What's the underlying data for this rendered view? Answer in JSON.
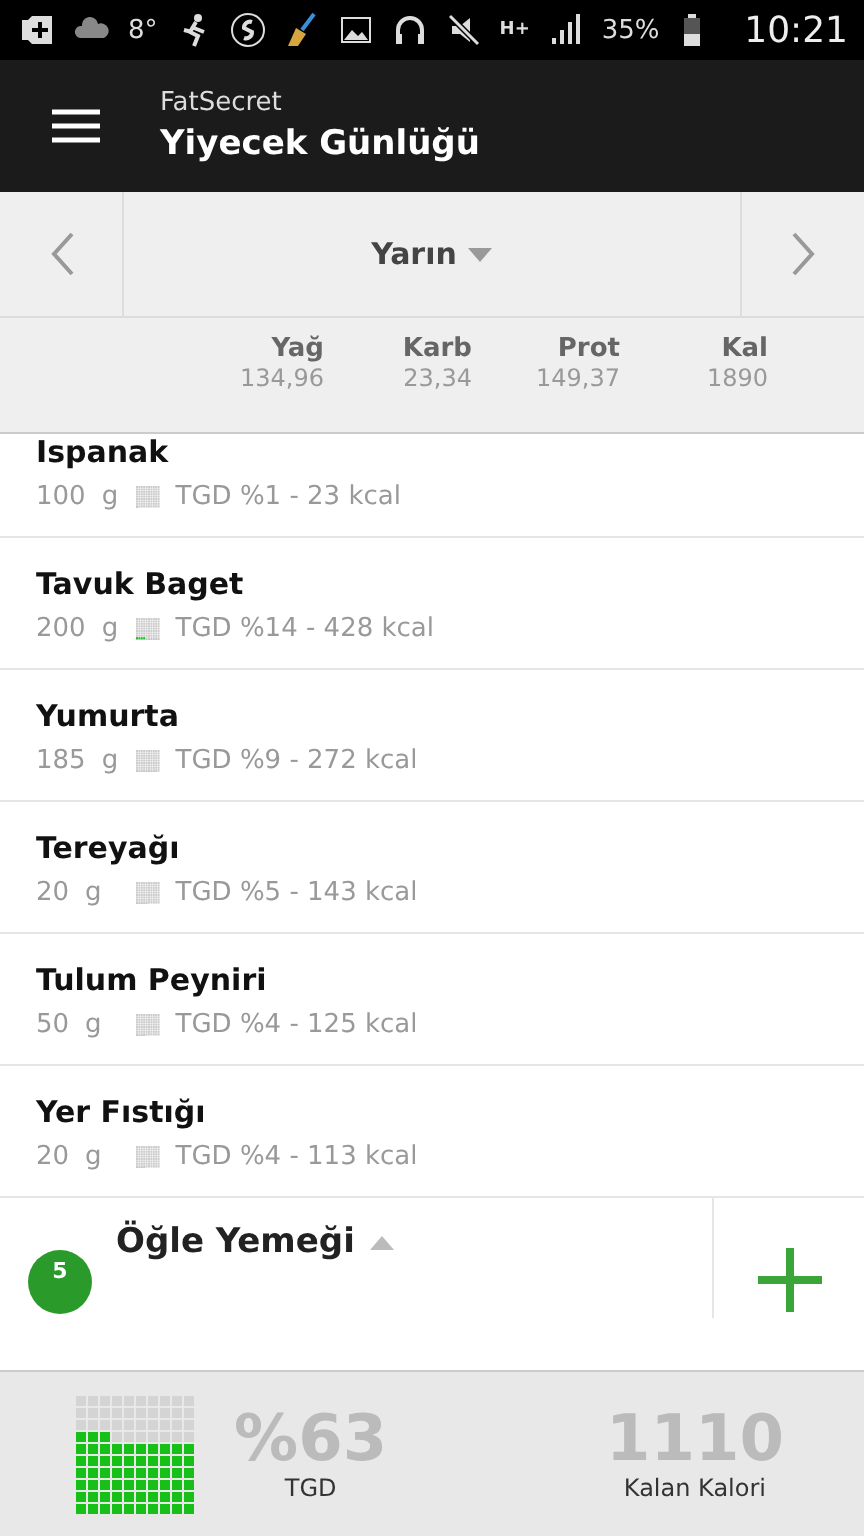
{
  "status_bar": {
    "temperature": "8°",
    "network": "H+",
    "battery": "35%",
    "time": "10:21"
  },
  "app_bar": {
    "app_name": "FatSecret",
    "title": "Yiyecek Günlüğü"
  },
  "date_nav": {
    "date": "Yarın"
  },
  "summary": [
    {
      "label": "Yağ",
      "value": "134,96"
    },
    {
      "label": "Karb",
      "value": "23,34"
    },
    {
      "label": "Prot",
      "value": "149,37"
    },
    {
      "label": "Kal",
      "value": "1890"
    }
  ],
  "foods": [
    {
      "name": "Ispanak",
      "amount": "100",
      "unit": "g",
      "detail": "TGD %1 - 23 kcal"
    },
    {
      "name": "Tavuk Baget",
      "amount": "200",
      "unit": "g",
      "detail": "TGD %14 - 428 kcal"
    },
    {
      "name": "Yumurta",
      "amount": "185",
      "unit": "g",
      "detail": "TGD %9 - 272 kcal"
    },
    {
      "name": "Tereyağı",
      "amount": "20",
      "unit": "g",
      "detail": "TGD %5 - 143 kcal"
    },
    {
      "name": "Tulum Peyniri",
      "amount": "50",
      "unit": "g",
      "detail": "TGD %4 - 125 kcal"
    },
    {
      "name": "Yer Fıstığı",
      "amount": "20",
      "unit": "g",
      "detail": "TGD %4 - 113 kcal"
    }
  ],
  "meal": {
    "number": "5",
    "name": "Öğle Yemeği",
    "expanded": true
  },
  "footer": {
    "percent": "%63",
    "percent_label": "TGD",
    "remaining": "1110",
    "remaining_label": "Kalan Kalori"
  }
}
